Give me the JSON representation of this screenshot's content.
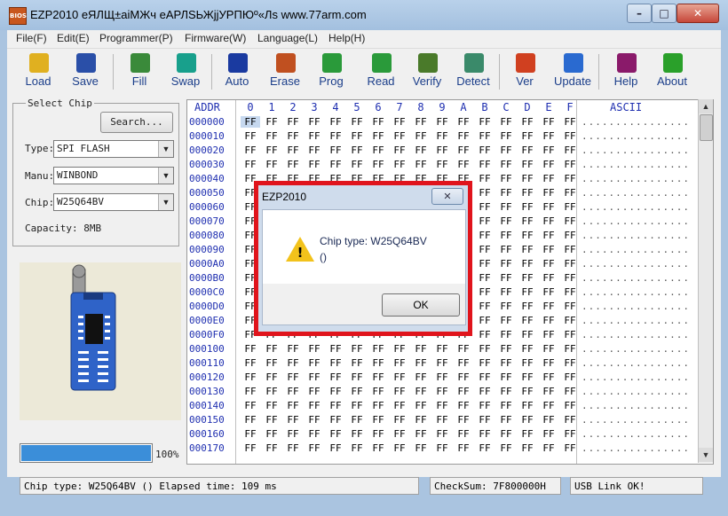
{
  "window": {
    "title": "EZP2010 еЯЛЩ±аіМЖч еАРЛSЬЖjjУРПЮº«Лs www.77arm.com",
    "icon_text": "BIOS"
  },
  "menu": [
    "File(F)",
    "Edit(E)",
    "Programmer(P)",
    "Firmware(W)",
    "Language(L)",
    "Help(H)"
  ],
  "toolbar": [
    {
      "label": "Load",
      "icon": "folder-icon",
      "color": "#e0b020"
    },
    {
      "label": "Save",
      "icon": "floppy-icon",
      "color": "#2a4fa8"
    },
    {
      "label": "Fill",
      "icon": "grid-fill-icon",
      "color": "#3a8a3a"
    },
    {
      "label": "Swap",
      "icon": "swap-icon",
      "color": "#18a08c"
    },
    {
      "label": "Auto",
      "icon": "auto-icon",
      "color": "#1a3aa0"
    },
    {
      "label": "Erase",
      "icon": "eraser-icon",
      "color": "#c05020"
    },
    {
      "label": "Prog",
      "icon": "prog-icon",
      "color": "#2a9a3a"
    },
    {
      "label": "Read",
      "icon": "read-icon",
      "color": "#2a9a3a"
    },
    {
      "label": "Verify",
      "icon": "verify-icon",
      "color": "#4a7a2a"
    },
    {
      "label": "Detect",
      "icon": "detect-icon",
      "color": "#3a8a6a"
    },
    {
      "label": "Ver",
      "icon": "windows-flag-icon",
      "color": "#d04020"
    },
    {
      "label": "Update",
      "icon": "globe-update-icon",
      "color": "#2a6ad0"
    },
    {
      "label": "Help",
      "icon": "help-book-icon",
      "color": "#8a1a6a"
    },
    {
      "label": "About",
      "icon": "info-icon",
      "color": "#2aa02a"
    }
  ],
  "select_chip": {
    "legend": "Select Chip",
    "search_label": "Search...",
    "type_label": "Type:",
    "type_value": "SPI FLASH",
    "manu_label": "Manu:",
    "manu_value": "WINBOND",
    "chip_label": "Chip:",
    "chip_value": "W25Q64BV",
    "capacity": "Capacity: 8MB"
  },
  "progress": {
    "fraction": 1.0,
    "text": "100%"
  },
  "hex": {
    "addr_header": "ADDR",
    "columns": [
      "0",
      "1",
      "2",
      "3",
      "4",
      "5",
      "6",
      "7",
      "8",
      "9",
      "A",
      "B",
      "C",
      "D",
      "E",
      "F"
    ],
    "ascii_header": "ASCII",
    "cell_value": "FF",
    "ascii_row": "................",
    "addresses": [
      "000000",
      "000010",
      "000020",
      "000030",
      "000040",
      "000050",
      "000060",
      "000070",
      "000080",
      "000090",
      "0000A0",
      "0000B0",
      "0000C0",
      "0000D0",
      "0000E0",
      "0000F0",
      "000100",
      "000110",
      "000120",
      "000130",
      "000140",
      "000150",
      "000160",
      "000170"
    ]
  },
  "status": {
    "chip_type": "Chip type: W25Q64BV    ()   Elapsed time: 109 ms",
    "checksum": "CheckSum: 7F800000H",
    "usb": "USB Link OK!"
  },
  "dialog": {
    "title": "EZP2010",
    "message": "Chip type: W25Q64BV",
    "detail": "()",
    "ok_label": "OK",
    "close_label": "✕",
    "highlight_color": "#e0141c"
  },
  "colors": {
    "address_blue": "#1f2fb0",
    "progress_blue": "#3b8ed9"
  }
}
